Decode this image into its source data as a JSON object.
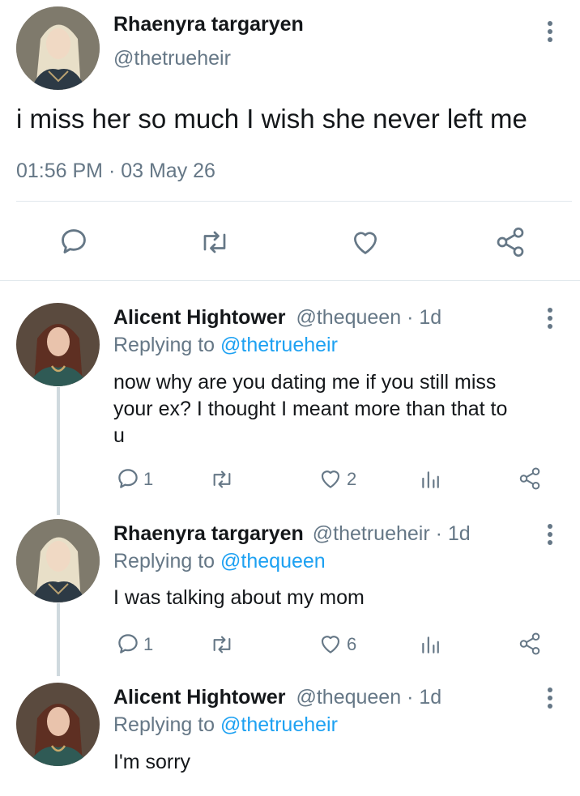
{
  "main_tweet": {
    "display_name": "Rhaenyra targaryen",
    "handle": "@thetrueheir",
    "text": "i miss her so much I wish she never left me",
    "timestamp": "01:56 PM · 03 May 26",
    "actions": [
      "reply-icon",
      "retweet-icon",
      "like-icon",
      "share-icon"
    ]
  },
  "replies": [
    {
      "display_name": "Alicent Hightower",
      "handle_time": "@thequeen · 1d",
      "replying_prefix": "Replying to ",
      "replying_to": "@thetrueheir",
      "text_lines": [
        "now why are you dating me if you still miss",
        "your ex? I thought I meant more than that to",
        "u"
      ],
      "reply_count": "1",
      "like_count": "2"
    },
    {
      "display_name": "Rhaenyra targaryen",
      "handle_time": "@thetrueheir · 1d",
      "replying_prefix": "Replying to ",
      "replying_to": "@thequeen",
      "text_lines": [
        "I was talking about my mom"
      ],
      "reply_count": "1",
      "like_count": "6"
    },
    {
      "display_name": "Alicent Hightower",
      "handle_time": "@thequeen · 1d",
      "replying_prefix": "Replying to ",
      "replying_to": "@thetrueheir",
      "text_lines": [
        "I'm sorry"
      ]
    }
  ],
  "colors": {
    "text": "#14171a",
    "secondary": "#657786",
    "link": "#1da1f2",
    "divider": "#e1e8ed"
  }
}
